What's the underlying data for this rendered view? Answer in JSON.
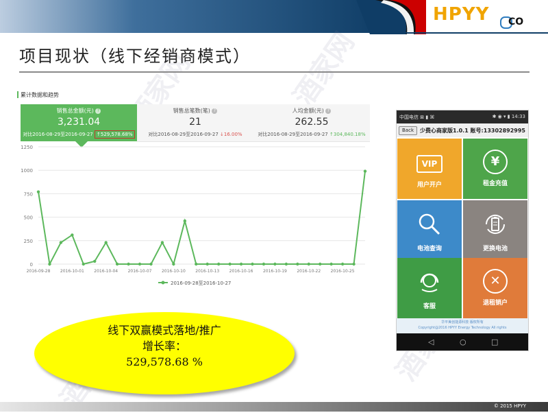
{
  "header": {
    "logo_text": "HPYY",
    "logo_suffix": "CO",
    "brand_colors": [
      "#1d4e78",
      "#cc0000",
      "#f0a400"
    ]
  },
  "title": "项目现状（线下经销商模式）",
  "dashboard": {
    "section_title": "累计数据和趋势",
    "kpis": [
      {
        "label": "销售总金额(元)",
        "value": "3,231.04",
        "compare": "对比2016-08-29至2016-09-27",
        "change": "529,578.68%",
        "direction": "up",
        "active": true
      },
      {
        "label": "销售总笔数(笔)",
        "value": "21",
        "compare": "对比2016-08-29至2016-09-27",
        "change": "16.00%",
        "direction": "down",
        "active": false
      },
      {
        "label": "人均金额(元)",
        "value": "262.55",
        "compare": "对比2016-08-29至2016-09-27",
        "change": "304,840.18%",
        "direction": "up",
        "active": false
      }
    ],
    "up_arrow": "↑",
    "down_arrow": "↓",
    "help_glyph": "?"
  },
  "chart_data": {
    "type": "line",
    "x": [
      "2016-09-28",
      "2016-09-29",
      "2016-09-30",
      "2016-10-01",
      "2016-10-02",
      "2016-10-03",
      "2016-10-04",
      "2016-10-05",
      "2016-10-06",
      "2016-10-07",
      "2016-10-08",
      "2016-10-09",
      "2016-10-10",
      "2016-10-11",
      "2016-10-12",
      "2016-10-13",
      "2016-10-14",
      "2016-10-15",
      "2016-10-16",
      "2016-10-17",
      "2016-10-18",
      "2016-10-19",
      "2016-10-20",
      "2016-10-21",
      "2016-10-22",
      "2016-10-23",
      "2016-10-24",
      "2016-10-25",
      "2016-10-26",
      "2016-10-27"
    ],
    "x_tick_labels": [
      "2016-09-28",
      "2016-10-01",
      "2016-10-04",
      "2016-10-07",
      "2016-10-10",
      "2016-10-13",
      "2016-10-16",
      "2016-10-19",
      "2016-10-22",
      "2016-10-25"
    ],
    "series": [
      {
        "name": "2016-09-28至2016-10-27",
        "values": [
          770,
          0,
          230,
          310,
          0,
          30,
          230,
          0,
          0,
          0,
          0,
          230,
          0,
          460,
          0,
          0,
          0,
          0,
          0,
          0,
          0,
          0,
          0,
          0,
          0,
          0,
          0,
          0,
          0,
          990
        ],
        "color": "#5cb85c"
      }
    ],
    "ylim": [
      0,
      1250
    ],
    "y_ticks": [
      0,
      250,
      500,
      750,
      1000,
      1250
    ],
    "grid": true,
    "legend": "bottom-center",
    "title": "",
    "xlabel": "",
    "ylabel": ""
  },
  "callout": {
    "line1": "线下双赢模式落地/推广",
    "line2": "增长率：",
    "line3": "529,578.68 %"
  },
  "phone": {
    "status_left": "中国电信 ⊠ ▮ ⌘",
    "status_right": "✱ ◉ ▾ ▮ 14:33",
    "back_label": "Back",
    "app_title": "少费心商家版1.0.1 账号:13302892995",
    "tiles": [
      {
        "label": "用户开户",
        "icon": "vip-icon",
        "icon_text": "VIP",
        "color": "#f0a72b"
      },
      {
        "label": "租金充值",
        "icon": "yen-icon",
        "icon_text": "¥",
        "color": "#4ea54a"
      },
      {
        "label": "电池查询",
        "icon": "magnifier-icon",
        "icon_text": "",
        "color": "#3d8ac9"
      },
      {
        "label": "更换电池",
        "icon": "battery-swap-icon",
        "icon_text": "",
        "color": "#8a8480"
      },
      {
        "label": "客服",
        "icon": "headset-icon",
        "icon_text": "",
        "color": "#3f9c45"
      },
      {
        "label": "退租销户",
        "icon": "cancel-icon",
        "icon_text": "✕",
        "color": "#e07b3a"
      }
    ],
    "footer_line1": "华平美创能源科技 版权所有",
    "footer_line2": "Copyright@2016 HPYY Energy Technology All rights",
    "nav": [
      "◁",
      "○",
      "□"
    ]
  },
  "footer": {
    "copyright": "© 2015 HPYY"
  },
  "watermark": "酒家网"
}
